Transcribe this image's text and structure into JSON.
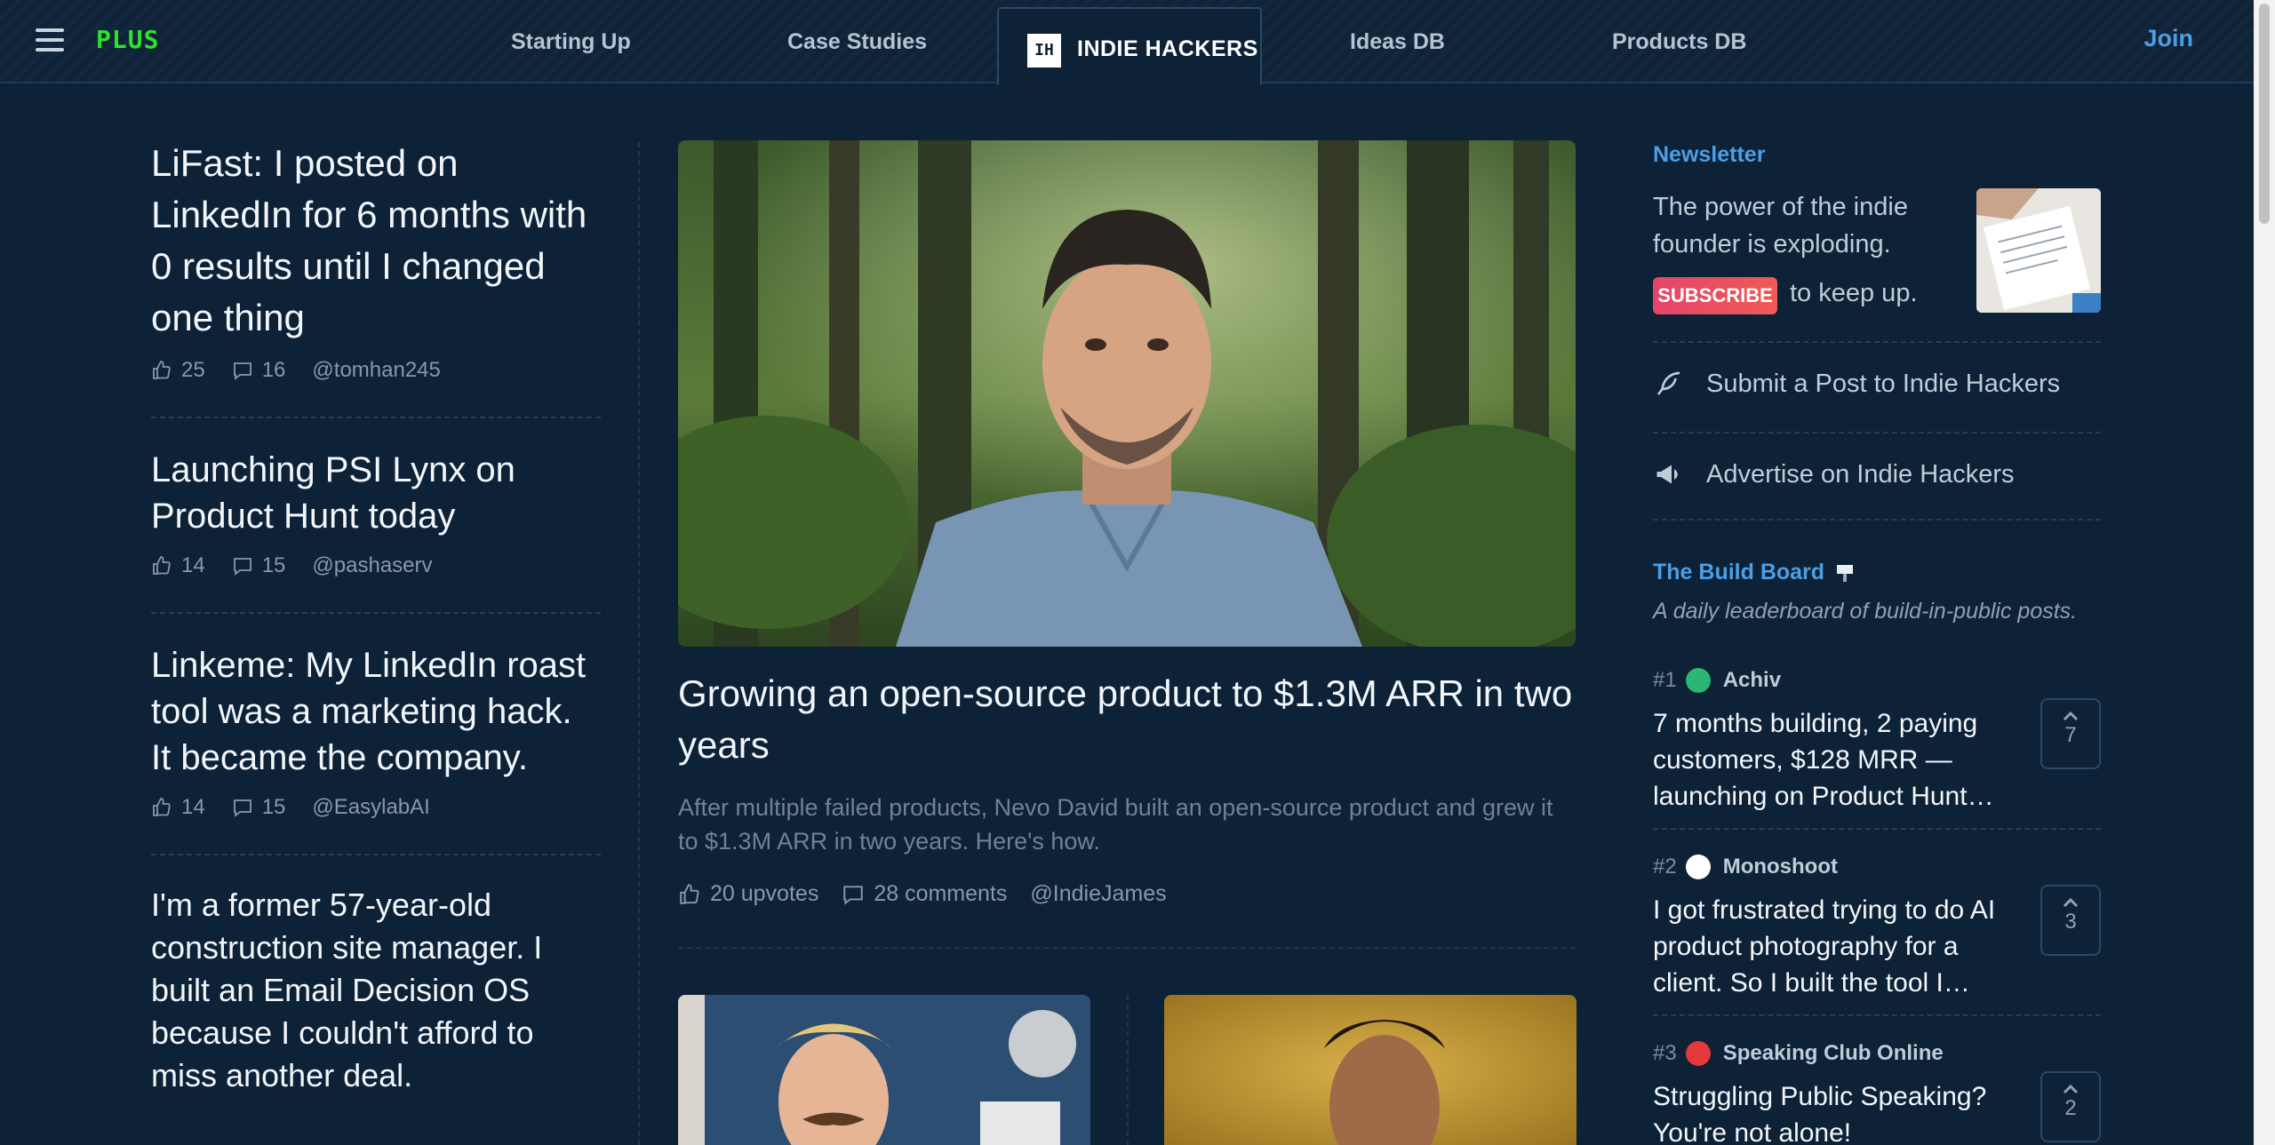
{
  "nav": {
    "plus": "PLUS",
    "links": [
      "Starting Up",
      "Case Studies",
      "Ideas DB",
      "Products DB"
    ],
    "active": {
      "badge": "IH",
      "label": "INDIE HACKERS"
    },
    "join": "Join"
  },
  "left_posts": [
    {
      "title": "LiFast: I posted on LinkedIn for 6 months with 0 results until I changed one thing",
      "likes": "25",
      "comments": "16",
      "author": "@tomhan245"
    },
    {
      "title": "Launching PSI Lynx on Product Hunt today",
      "likes": "14",
      "comments": "15",
      "author": "@pashaserv"
    },
    {
      "title": "Linkeme: My LinkedIn roast tool was a marketing hack. It became the company.",
      "likes": "14",
      "comments": "15",
      "author": "@EasylabAI"
    },
    {
      "title": "I'm a former 57-year-old construction site manager. I built an Email Decision OS because I couldn't afford to miss another deal."
    }
  ],
  "featured": {
    "title": "Growing an open-source product to $1.3M ARR in two years",
    "description": "After multiple failed products, Nevo David built an open-source product and grew it to $1.3M ARR in two years. Here's how.",
    "upvotes": "20 upvotes",
    "comments": "28 comments",
    "author": "@IndieJames"
  },
  "sidebar": {
    "newsletter": {
      "heading": "Newsletter",
      "text": "The power of the indie founder is exploding.",
      "subscribe": "SUBSCRIBE",
      "tail": "to keep up."
    },
    "submit_post": "Submit a Post to Indie Hackers",
    "advertise": "Advertise on Indie Hackers",
    "build_board": {
      "heading": "The Build Board",
      "subtitle": "A daily leaderboard of build-in-public posts.",
      "items": [
        {
          "rank": "#1",
          "name": "Achiv",
          "title": "7 months building, 2 paying customers, $128 MRR — launching on Product Hunt…",
          "votes": "7",
          "logo_color": "#2bb673"
        },
        {
          "rank": "#2",
          "name": "Monoshoot",
          "title": "I got frustrated trying to do AI product photography for a client. So I built the tool I…",
          "votes": "3",
          "logo_color": "#ffffff"
        },
        {
          "rank": "#3",
          "name": "Speaking Club Online",
          "title": "Struggling Public Speaking? You're not alone!",
          "votes": "2",
          "logo_color": "#e5383b"
        }
      ]
    }
  },
  "colors": {
    "background": "#0d2137",
    "accent": "#4a9fe6",
    "plus": "#2ee02e",
    "subscribe": "#e5446b"
  }
}
